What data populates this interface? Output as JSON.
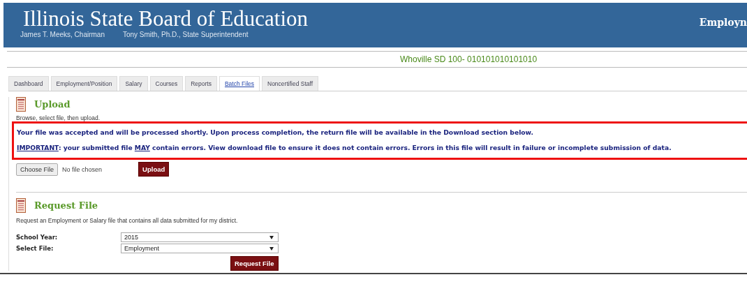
{
  "header": {
    "title": "Illinois State Board of Education",
    "officials": [
      "James T. Meeks, Chairman",
      "Tony Smith, Ph.D., State Superintendent"
    ],
    "right_title": "Employn"
  },
  "district": "Whoville SD 100- 010101010101010",
  "tabs": [
    {
      "label": "Dashboard",
      "selected": false
    },
    {
      "label": "Employment/Position",
      "selected": false
    },
    {
      "label": "Salary",
      "selected": false
    },
    {
      "label": "Courses",
      "selected": false
    },
    {
      "label": "Reports",
      "selected": false
    },
    {
      "label": "Batch Files",
      "selected": true
    },
    {
      "label": "Noncertified Staff",
      "selected": false
    }
  ],
  "upload": {
    "title": "Upload",
    "hint": "Browse, select file, then upload.",
    "messages": [
      [
        {
          "text": "Your file was accepted and will be processed shortly. Upon process completion, the return file will be available in the Download section below.",
          "underline": false
        }
      ],
      [
        {
          "text": "IMPORTANT",
          "underline": true
        },
        {
          "text": ": your submitted file ",
          "underline": false
        },
        {
          "text": "MAY",
          "underline": true
        },
        {
          "text": " contain errors. View download file to ensure it does not contain errors. Errors in this file will result in failure or incomplete submission of data.",
          "underline": false
        }
      ]
    ],
    "choose_button": "Choose File",
    "file_status": "No file chosen",
    "upload_button": "Upload"
  },
  "request": {
    "title": "Request File",
    "description": "Request an Employment or Salary file that contains all data submitted for my district.",
    "fields": [
      {
        "label": "School Year:",
        "value": "2015"
      },
      {
        "label": "Select File:",
        "value": "Employment"
      }
    ],
    "button": "Request File"
  }
}
